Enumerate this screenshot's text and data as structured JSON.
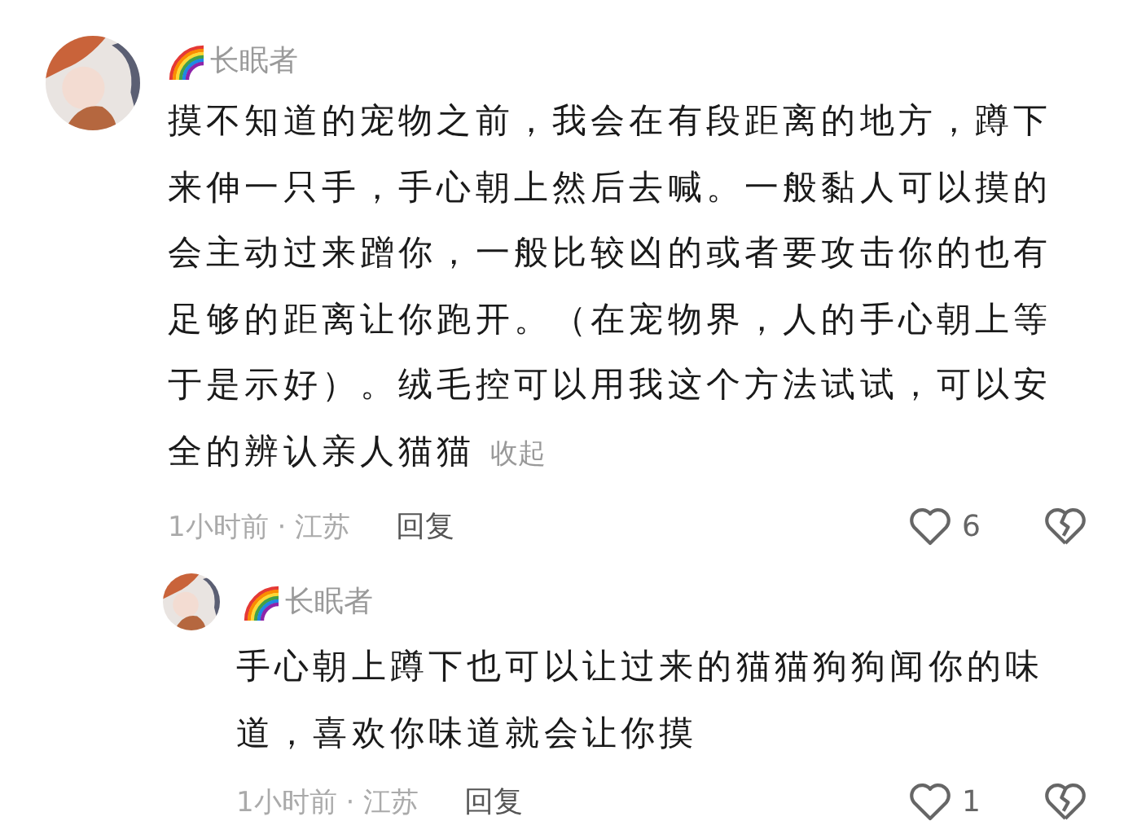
{
  "comment": {
    "name": "长眠者",
    "text": "摸不知道的宠物之前，我会在有段距离的地方，蹲下来伸一只手，手心朝上然后去喊。一般黏人可以摸的会主动过来蹭你，一般比较凶的或者要攻击你的也有足够的距离让你跑开。（在宠物界，人的手心朝上等于是示好）。绒毛控可以用我这个方法试试，可以安全的辨认亲人猫猫",
    "collapse": "收起",
    "meta": "1小时前 · 江苏",
    "reply_button": "回复",
    "likes": "6",
    "replies": [
      {
        "name": "长眠者",
        "text": "手心朝上蹲下也可以让过来的猫猫狗狗闻你的味道，喜欢你味道就会让你摸",
        "meta": "1小时前 · 江苏",
        "reply_button": "回复",
        "likes": "1"
      }
    ]
  }
}
